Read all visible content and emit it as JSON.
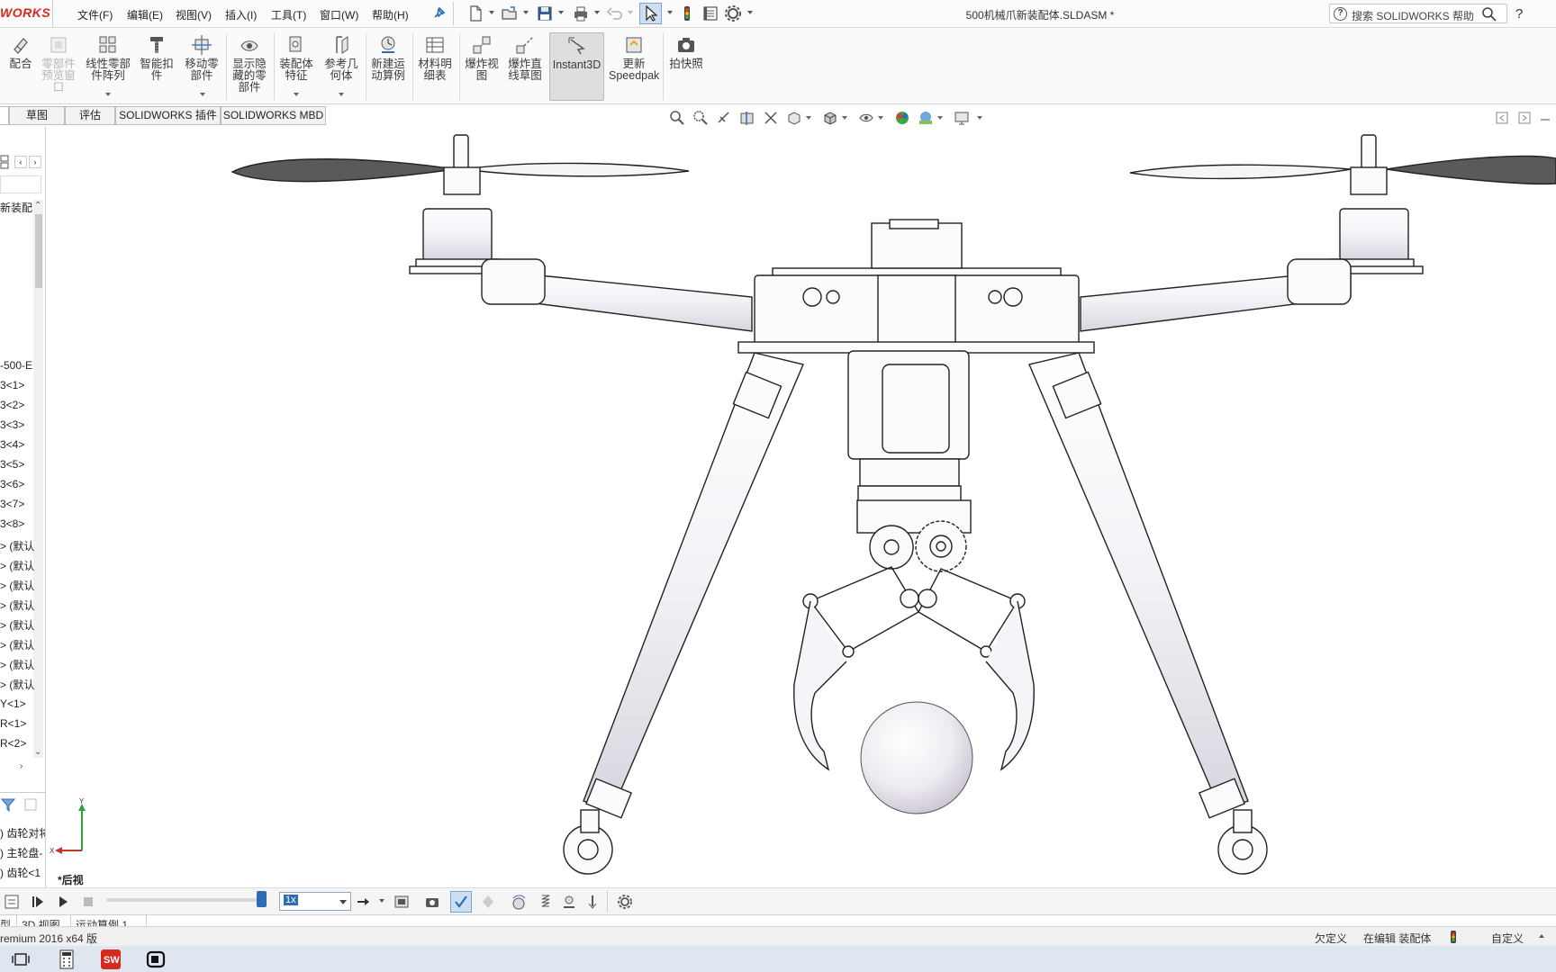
{
  "app": {
    "logo_text": "WORKS",
    "document_title": "500机械爪新装配体.SLDASM *",
    "brand_color": "#d52b1e",
    "accent_color": "#2d6db5"
  },
  "menu": {
    "items": [
      "文件(F)",
      "编辑(E)",
      "视图(V)",
      "插入(I)",
      "工具(T)",
      "窗口(W)",
      "帮助(H)"
    ],
    "pin_icon": "pin-icon"
  },
  "quick_access": [
    "new-icon",
    "open-icon",
    "save-icon",
    "print-icon",
    "undo-icon",
    "select-icon",
    "rebuild-icon",
    "file-properties-icon",
    "options-icon"
  ],
  "search": {
    "placeholder": "搜索 SOLIDWORKS 帮助",
    "help_icon": "?"
  },
  "help": {
    "label": "?"
  },
  "ribbon": {
    "buttons": [
      {
        "label": "配合",
        "icon": "mate-icon",
        "enabled": true
      },
      {
        "label": "零部件预览窗口",
        "icon": "component-preview-icon",
        "enabled": false
      },
      {
        "label": "线性零部件阵列",
        "icon": "linear-pattern-icon",
        "enabled": true
      },
      {
        "label": "智能扣件",
        "icon": "smart-fasteners-icon",
        "enabled": true
      },
      {
        "label": "移动零部件",
        "icon": "move-component-icon",
        "enabled": true
      },
      {
        "label": "显示隐藏的零部件",
        "icon": "show-hidden-icon",
        "enabled": true
      },
      {
        "label": "装配体特征",
        "icon": "assembly-features-icon",
        "enabled": true
      },
      {
        "label": "参考几何体",
        "icon": "reference-geometry-icon",
        "enabled": true
      },
      {
        "label": "新建运动算例",
        "icon": "new-motion-study-icon",
        "enabled": true
      },
      {
        "label": "材料明细表",
        "icon": "bom-icon",
        "enabled": true
      },
      {
        "label": "爆炸视图",
        "icon": "exploded-view-icon",
        "enabled": true
      },
      {
        "label": "爆炸直线草图",
        "icon": "explode-line-sketch-icon",
        "enabled": true
      },
      {
        "label": "Instant3D",
        "icon": "instant3d-icon",
        "enabled": true
      },
      {
        "label": "更新Speedpak",
        "icon": "speedpak-icon",
        "enabled": true
      },
      {
        "label": "拍快照",
        "icon": "snapshot-icon",
        "enabled": true
      }
    ]
  },
  "tabs": [
    {
      "label": "草图"
    },
    {
      "label": "评估"
    },
    {
      "label": "SOLIDWORKS 插件"
    },
    {
      "label": "SOLIDWORKS MBD"
    }
  ],
  "feature_tree": {
    "header_label": "新装配",
    "rows": [
      "-500-E",
      "3<1>",
      "3<2>",
      "3<3>",
      "3<4>",
      "3<5>",
      "3<6>",
      "3<7>",
      "3<8>",
      "> (默认",
      "> (默认",
      "> (默认",
      "> (默认",
      "> (默认",
      "> (默认",
      "> (默认",
      "> (默认",
      "Y<1>",
      "R<1>",
      "R<2>"
    ],
    "motion_rows": [
      ") 齿轮对将",
      ") 主轮盘-",
      ") 齿轮<1"
    ]
  },
  "viewport": {
    "view_label": "*后视",
    "triad": {
      "x_label": "X",
      "y_label": "Y"
    }
  },
  "motion": {
    "speed": "1x",
    "progress": 0.97
  },
  "bottom_tabs": [
    {
      "label": "型"
    },
    {
      "label": "3D 视图"
    },
    {
      "label": "运动算例 1"
    }
  ],
  "status": {
    "version": "remium 2016 x64 版",
    "underdefined": "欠定义",
    "editing": "在编辑 装配体",
    "custom": "自定义"
  },
  "taskbar": [
    "task-view-icon",
    "calculator-icon",
    "solidworks-icon",
    "camera-icon"
  ]
}
